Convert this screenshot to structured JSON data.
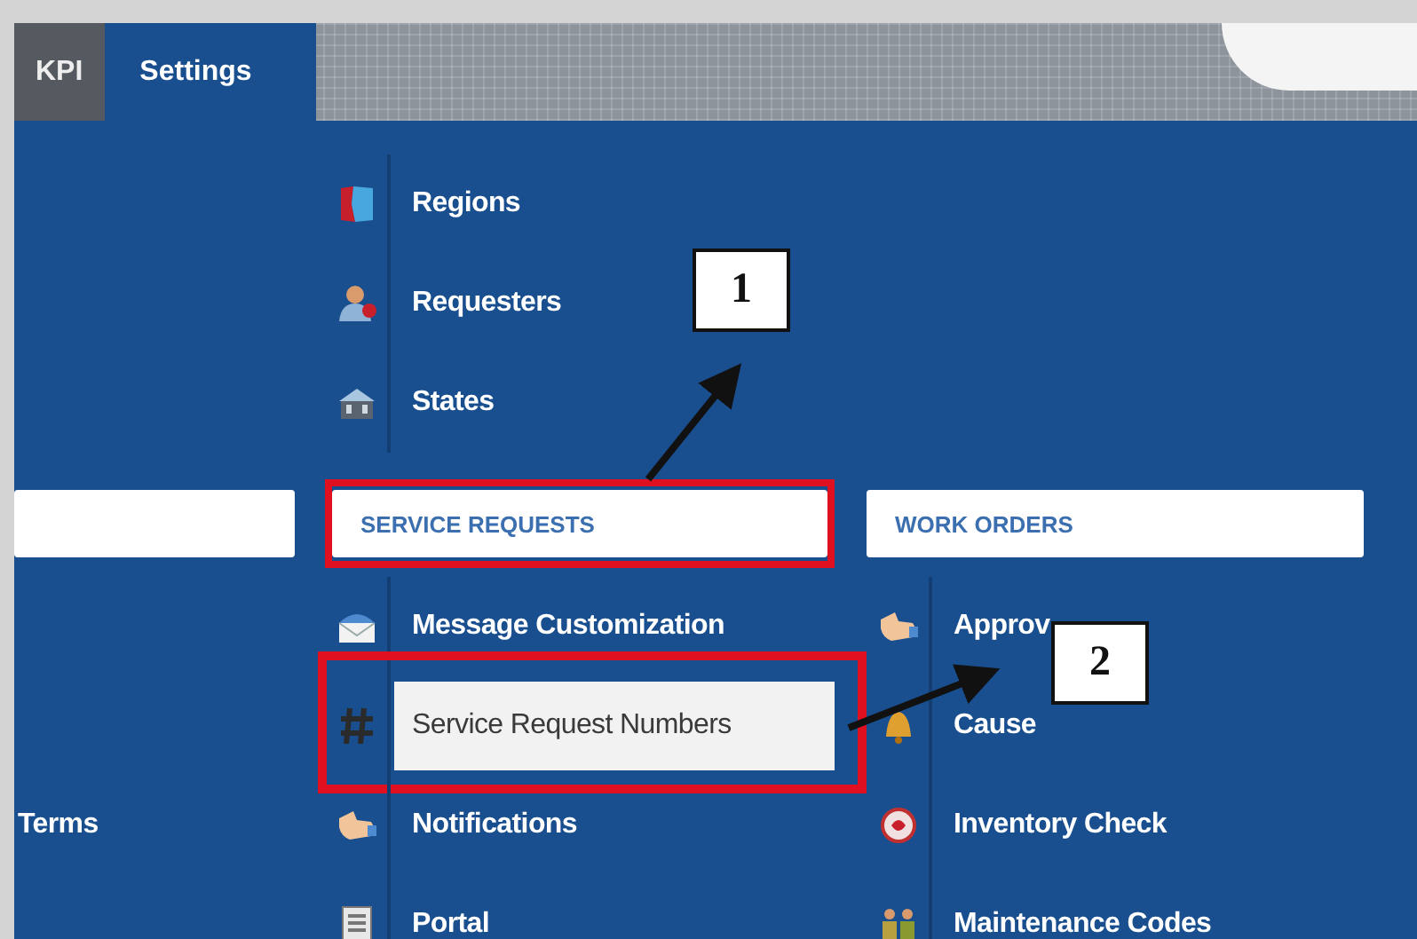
{
  "tabs": [
    {
      "label": "KPI",
      "selected": false
    },
    {
      "label": "Settings",
      "selected": true
    }
  ],
  "columns": [
    {
      "header": {
        "outlined": false
      },
      "items": [
        {
          "label": "Terms",
          "selected": false,
          "outlined": false
        }
      ]
    },
    {
      "upper_items": [
        {
          "label": "Regions",
          "selected": false
        },
        {
          "label": "Requesters",
          "selected": false
        },
        {
          "label": "States",
          "selected": false
        }
      ],
      "header": {
        "title": "SERVICE REQUESTS",
        "outlined": true
      },
      "items": [
        {
          "label": "Message Customization",
          "selected": false,
          "outlined": false
        },
        {
          "label": "Service Request Numbers",
          "selected": true,
          "outlined": true
        },
        {
          "label": "Notifications",
          "selected": false,
          "outlined": false
        },
        {
          "label": "Portal",
          "selected": false,
          "outlined": false
        }
      ]
    },
    {
      "header": {
        "title": "WORK ORDERS",
        "outlined": false
      },
      "items": [
        {
          "label": "Approv",
          "selected": false,
          "outlined": false
        },
        {
          "label": "Cause",
          "selected": false,
          "outlined": false
        },
        {
          "label": "Inventory Check",
          "selected": false,
          "outlined": false
        },
        {
          "label": "Maintenance Codes",
          "selected": false,
          "outlined": false
        }
      ]
    }
  ],
  "callouts": [
    {
      "label": "1"
    },
    {
      "label": "2"
    }
  ]
}
